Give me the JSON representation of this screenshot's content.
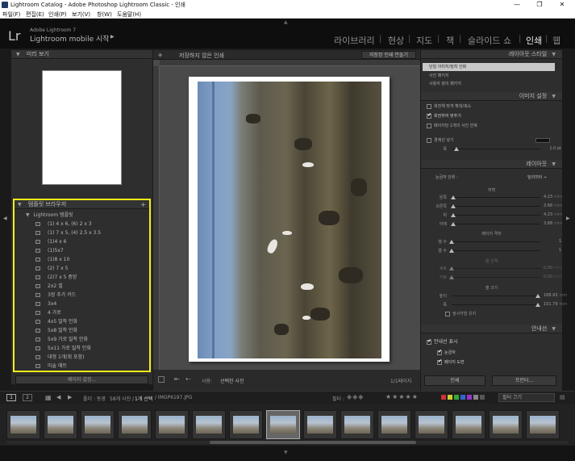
{
  "window": {
    "title": "Lightroom Catalog - Adobe Photoshop Lightroom Classic - 인쇄",
    "minimize": "—",
    "maximize": "❐",
    "close": "✕"
  },
  "menu": [
    "파일(F)",
    "편집(E)",
    "인쇄(P)",
    "보기(V)",
    "창(W)",
    "도움말(H)"
  ],
  "header": {
    "logo": "Lr",
    "brand_line1": "Adobe Lightroom 7",
    "brand_line2": "Lightroom mobile 시작",
    "modules": [
      "라이브러리",
      "현상",
      "지도",
      "책",
      "슬라이드 쇼",
      "인쇄",
      "웹"
    ],
    "active_module": "인쇄"
  },
  "left_panel": {
    "preview_title": "미리 보기",
    "template_browser_title": "템플릿 브라우저",
    "template_folder": "Lightroom 템플릿",
    "templates": [
      "(1) 4 x 6, (6) 2 x 3",
      "(1) 7 x 5, (4) 2.5 x 3.5",
      "(1)4 x 6",
      "(1)5x7",
      "(1)8 x 10",
      "(2) 7 x 5",
      "(2)7 x 5 중앙",
      "2x2 셀",
      "3장 추가 카드",
      "3x4 ",
      "4 가로",
      "4x5 밀착 인화",
      "5x8 밀착 인화",
      "5x9 가로 밀착 인화",
      "5x11 가로 밀착 인화",
      "대형 1개(획 포함)",
      "미술 매트"
    ],
    "page_setup_button": "페이지 설정..."
  },
  "center": {
    "doc_title": "저장하지 않은 인쇄",
    "create_saved_print": "저장된 인쇄 만들기",
    "use_label": "사용:",
    "use_value": "선택한 사진",
    "page_count": "1/1페이지"
  },
  "right_panel": {
    "layout_style_title": "레이아웃 스타일",
    "layout_styles": [
      "단일 이미지/밀착 인화",
      "사진 패키지",
      "사용자 정의 패키지"
    ],
    "image_settings_title": "이미지 설정",
    "image_settings": [
      {
        "label": "회전해 맞게 확대/축소",
        "checked": false
      },
      {
        "label": "회전하여 맞추기",
        "checked": true
      },
      {
        "label": "페이지당 1개의 사진 반복",
        "checked": false
      }
    ],
    "stroke_label": "경계선 넣기",
    "stroke_width_label": "폭",
    "stroke_width_value": "1.0 pt",
    "stroke_fraction": 0.05,
    "layout_title": "레이아웃",
    "ruler_units_label": "눈금자 단위 :",
    "ruler_units_value": "밀리미터",
    "margins_title": "여백",
    "margins": [
      {
        "label": "왼쪽",
        "value": "4.23",
        "unit": "mm",
        "fraction": 0.02
      },
      {
        "label": "오른쪽",
        "value": "3.88",
        "unit": "mm",
        "fraction": 0.02
      },
      {
        "label": "위",
        "value": "4.23",
        "unit": "mm",
        "fraction": 0.02
      },
      {
        "label": "아래",
        "value": "3.88",
        "unit": "mm",
        "fraction": 0.02
      }
    ],
    "page_grid_title": "페이지 격자",
    "page_grid": [
      {
        "label": "행 수",
        "value": "1",
        "fraction": 0.0
      },
      {
        "label": "열 수",
        "value": "1",
        "fraction": 0.0
      }
    ],
    "cell_spacing_title": "셀 간격",
    "cell_spacing": [
      {
        "label": "세로",
        "value": "0.00",
        "unit": "mm",
        "fraction": 0.0
      },
      {
        "label": "가로",
        "value": "0.00",
        "unit": "mm",
        "fraction": 0.0
      }
    ],
    "cell_size_title": "셀 크기",
    "cell_size": [
      {
        "label": "높이",
        "value": "188.93",
        "unit": "mm",
        "fraction": 0.97
      },
      {
        "label": "폭",
        "value": "101.79",
        "unit": "mm",
        "fraction": 0.97
      }
    ],
    "keep_square_label": "정사각형 유지",
    "guides_title": "안내선",
    "show_guides_label": "안내선 표시",
    "guides": [
      {
        "label": "눈금자",
        "checked": true
      },
      {
        "label": "페이지 도련",
        "checked": true
      }
    ],
    "print_button": "인쇄",
    "printer_button": "프린터..."
  },
  "filmstrip_bar": {
    "page1": "1",
    "page2": "2",
    "folder_label": "폴더 : 동광",
    "photo_count": "58개 사진 /",
    "selected": "1개 선택",
    "filename": "/ IMGP6197.JPG",
    "filter_label": "필터 :",
    "filter_off": "필터 끄기"
  },
  "colors": {
    "highlight": "#f6ee18",
    "active_module": "#eaeaea",
    "panel": "#2e2e2e"
  }
}
